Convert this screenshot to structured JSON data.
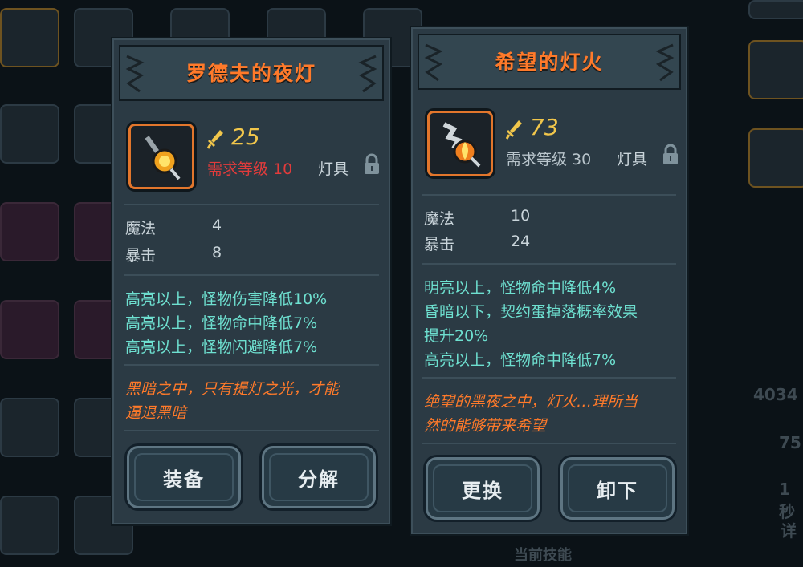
{
  "left_card": {
    "title": "罗德夫的夜灯",
    "attack": "25",
    "requirement": "需求等级 10",
    "item_type": "灯具",
    "stats": [
      {
        "name": "魔法",
        "value": "4"
      },
      {
        "name": "暴击",
        "value": "8"
      }
    ],
    "effects": [
      "高亮以上，怪物伤害降低10%",
      "高亮以上，怪物命中降低7%",
      "高亮以上，怪物闪避降低7%"
    ],
    "lore": [
      "黑暗之中，只有提灯之光，才能",
      "逼退黑暗"
    ],
    "buttons": {
      "primary": "装备",
      "secondary": "分解"
    },
    "requirement_color": "#e23b3b"
  },
  "right_card": {
    "title": "希望的灯火",
    "attack": "73",
    "requirement": "需求等级 30",
    "item_type": "灯具",
    "stats": [
      {
        "name": "魔法",
        "value": "10"
      },
      {
        "name": "暴击",
        "value": "24"
      }
    ],
    "effects": [
      "明亮以上，怪物命中降低4%",
      "昏暗以下，契约蛋掉落概率效果",
      "提升20%",
      "高亮以上，怪物命中降低7%"
    ],
    "lore": [
      "绝望的黑夜之中，灯火…理所当",
      "然的能够带来希望"
    ],
    "buttons": {
      "primary": "更换",
      "secondary": "卸下"
    },
    "requirement_color": "#b9c5cc"
  },
  "background": {
    "right_values": [
      "4034",
      "75",
      "1秒",
      "详"
    ],
    "bottom_label": "当前技能"
  },
  "icons": {
    "attack": "sword-icon",
    "lock": "lock-icon",
    "item_left": "lantern-icon",
    "item_right": "torch-icon"
  },
  "colors": {
    "title": "#ff7a2a",
    "effect": "#6ee0d0",
    "attack": "#f1c64b"
  }
}
